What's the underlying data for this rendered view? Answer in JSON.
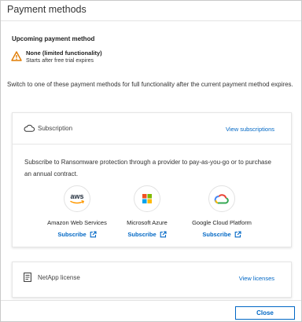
{
  "dialog": {
    "title": "Payment methods"
  },
  "upcoming": {
    "label": "Upcoming payment method",
    "name": "None (limited functionality)",
    "description": "Starts after free trial expires"
  },
  "switch_text": "Switch to one of these payment methods for full functionality after the current payment method expires.",
  "subscription": {
    "title": "Subscription",
    "link": "View subscriptions",
    "description": "Subscribe to Ransomware protection through a provider to pay-as-you-go or to purchase an annual contract.",
    "providers": [
      {
        "name": "Amazon Web Services",
        "logo_text": "aws",
        "link": "Subscribe"
      },
      {
        "name": "Microsoft Azure",
        "link": "Subscribe"
      },
      {
        "name": "Google Cloud Platform",
        "link": "Subscribe"
      }
    ]
  },
  "netapp": {
    "title": "NetApp license",
    "link": "View licenses"
  },
  "footer": {
    "close_label": "Close"
  },
  "colors": {
    "accent": "#0067c5",
    "warning": "#e07b00",
    "aws_orange": "#ff9900"
  }
}
